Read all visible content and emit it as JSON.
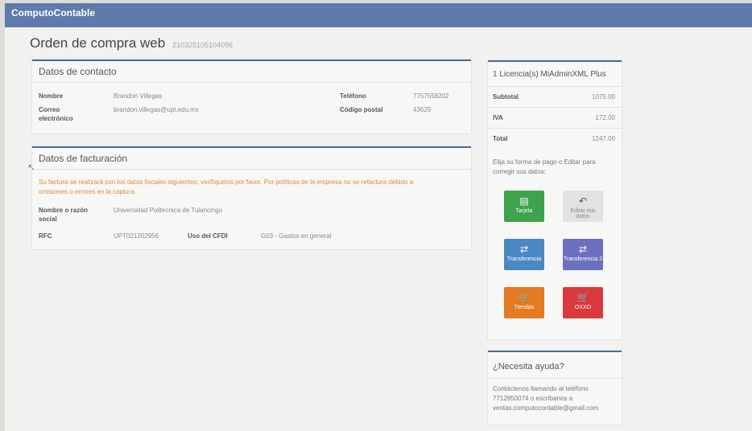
{
  "app": {
    "brand": "ComputoContable"
  },
  "page": {
    "title": "Orden de compra web",
    "order_number": "210325105104096"
  },
  "contact": {
    "header": "Datos de contacto",
    "name_label": "Nombre",
    "name_value": "Brandon Villegas",
    "email_label_line1": "Correo",
    "email_label_line2": "electrónico",
    "email_value": "brandon.villegas@upt.edu.mx",
    "phone_label": "Teléfono",
    "phone_value": "7757558202",
    "zip_label": "Código postal",
    "zip_value": "43629"
  },
  "billing": {
    "header": "Datos de facturación",
    "notice_line1": "Su factura se realizará con los datos fiscales siguientes; verifíquelos por favor. Por políticas de la empresa no se refactura debido a",
    "notice_line2": "omisiones o errores en la captura.",
    "business_label_line1": "Nombre o razón",
    "business_label_line2": "social",
    "business_value": "Universidad Politecnica de Tulancingo",
    "rfc_label": "RFC",
    "rfc_value": "UPT021202956",
    "cfdi_label": "Uso del CFDI",
    "cfdi_value": "G03 - Gastos en general"
  },
  "summary": {
    "header": "1 Licencia(s) MiAdminXML Plus",
    "subtotal_label": "Subtotal",
    "subtotal_value": "1075.00",
    "iva_label": "IVA",
    "iva_value": "172.00",
    "total_label": "Total",
    "total_value": "1247.00",
    "instructions_line1": "Elija su forma de pago o Editar para",
    "instructions_line2": "corregir sus datos:",
    "buttons": {
      "card": "Tarjeta",
      "edit": "Editar mis datos",
      "transfer": "Transferencia",
      "transfer2": "Transferencia 2",
      "stores": "Tiendas",
      "oxxo": "OXXO"
    },
    "colors": {
      "card": "#3fa24d",
      "edit": "#e2e2e0",
      "transfer": "#4a88c4",
      "transfer2": "#6d6fbf",
      "stores": "#e47a22",
      "oxxo": "#d9383c"
    }
  },
  "help": {
    "header": "¿Necesita ayuda?",
    "line1": "Contáctenos llamando al teléfono",
    "line2": "7712850074 o escríbanos a",
    "line3": "ventas.computocontable@gmail.com"
  }
}
